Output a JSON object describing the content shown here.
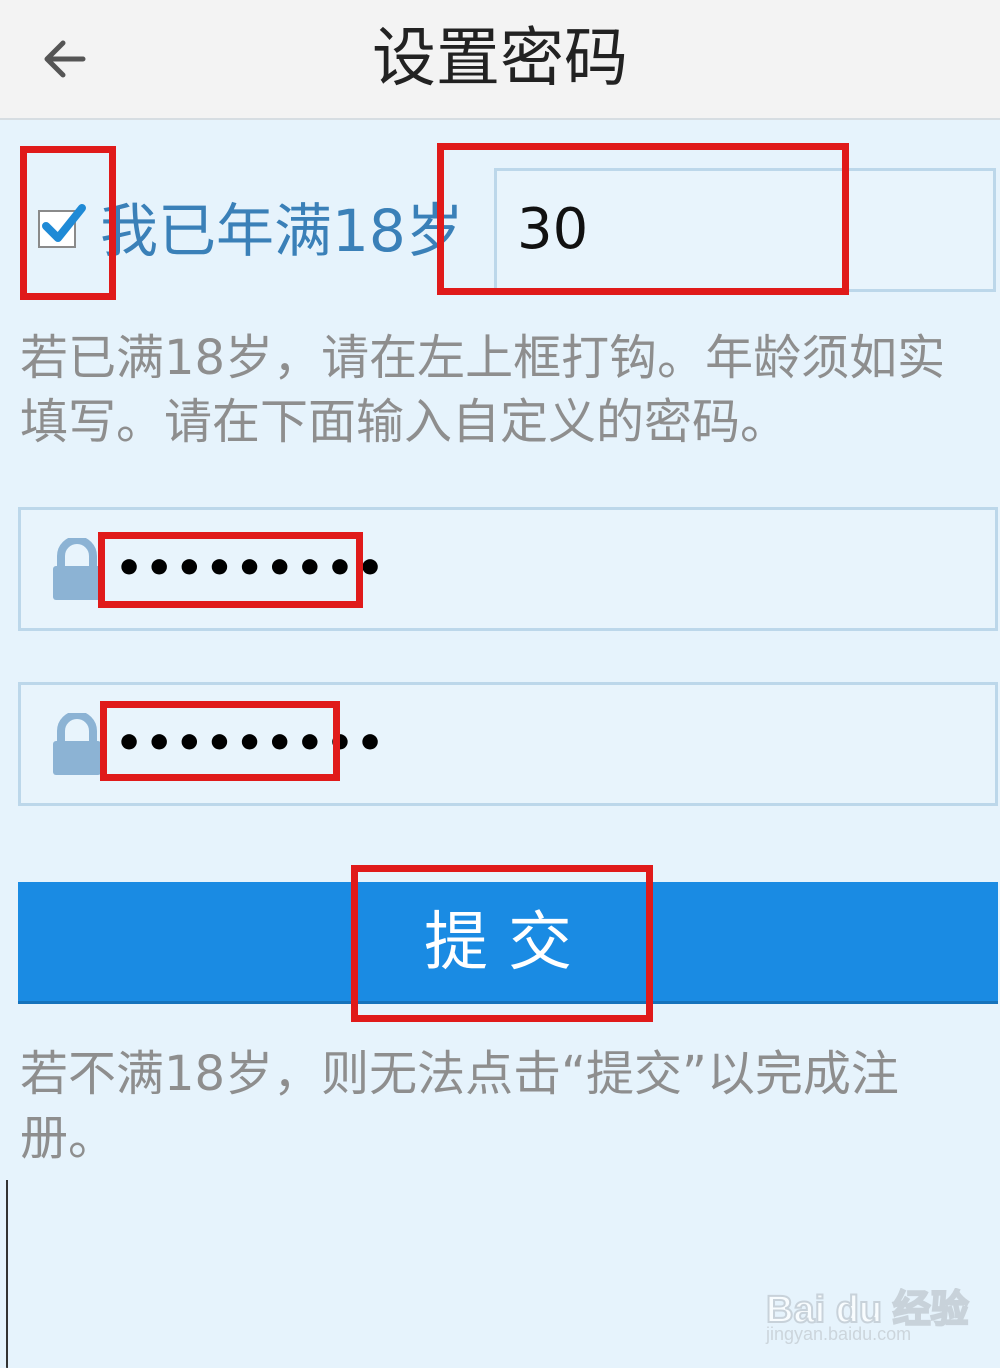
{
  "header": {
    "title": "设置密码",
    "back_icon": "arrow-left-icon"
  },
  "age": {
    "checked": true,
    "label": "我已年满18岁",
    "value": "30"
  },
  "hint_top": "若已满18岁，请在左上框打钩。年龄须如实填写。请在下面输入自定义的密码。",
  "password": {
    "field1_value": "•••••••••",
    "field2_value": "•••••••••",
    "lock_icon": "lock-icon"
  },
  "submit": {
    "label": "提交"
  },
  "hint_bottom": "若不满18岁，则无法点击“提交”以完成注册。",
  "watermark": {
    "logo": "Bai du 经验",
    "url": "jingyan.baidu.com"
  },
  "colors": {
    "background": "#e6f3fc",
    "accent": "#1a8be3",
    "annotation": "#e01a1a",
    "label_blue": "#3a80b8"
  }
}
